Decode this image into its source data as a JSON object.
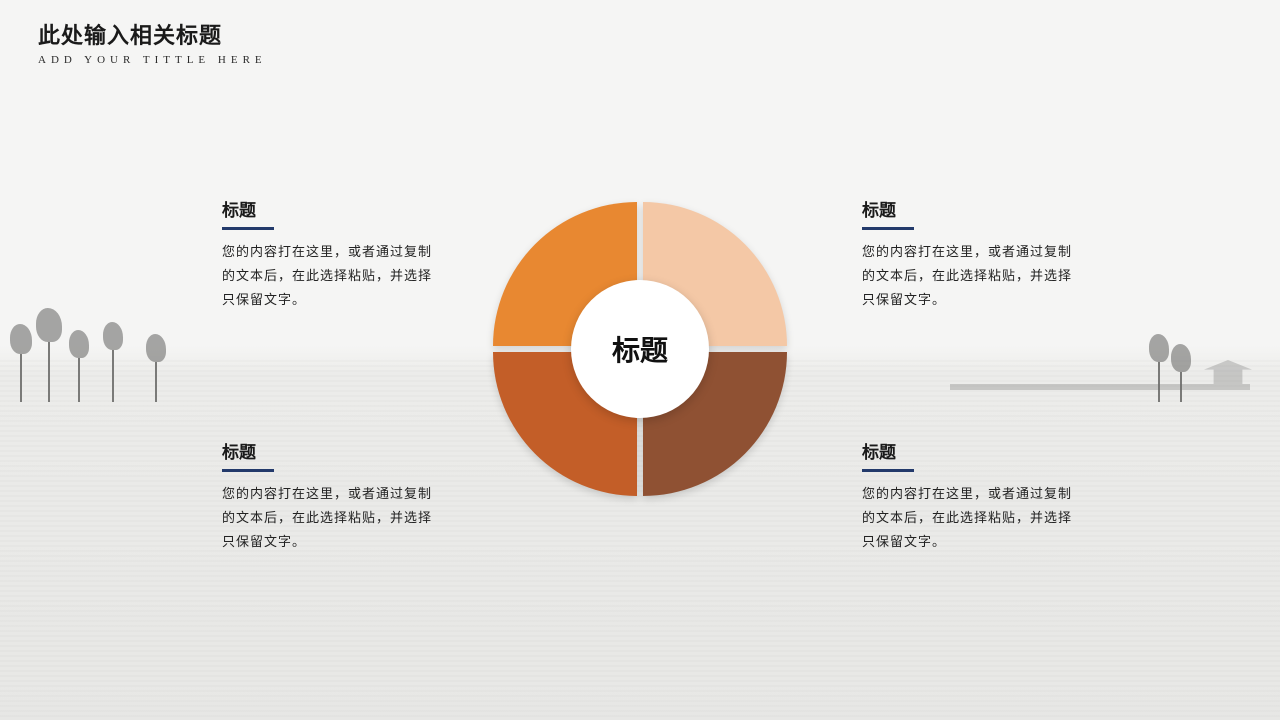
{
  "header": {
    "title": "此处输入相关标题",
    "subtitle": "ADD YOUR TITTLE HERE"
  },
  "center_label": "标题",
  "blocks": {
    "tl": {
      "title": "标题",
      "body": "您的内容打在这里，或者通过复制的文本后，在此选择粘贴，并选择只保留文字。"
    },
    "tr": {
      "title": "标题",
      "body": "您的内容打在这里，或者通过复制的文本后，在此选择粘贴，并选择只保留文字。"
    },
    "bl": {
      "title": "标题",
      "body": "您的内容打在这里，或者通过复制的文本后，在此选择粘贴，并选择只保留文字。"
    },
    "br": {
      "title": "标题",
      "body": "您的内容打在这里，或者通过复制的文本后，在此选择粘贴，并选择只保留文字。"
    }
  },
  "colors": {
    "quadrant_tl": "#e88831",
    "quadrant_tr": "#f4c8a6",
    "quadrant_bl": "#c35e28",
    "quadrant_br": "#8f5133",
    "rule": "#233a6b"
  }
}
